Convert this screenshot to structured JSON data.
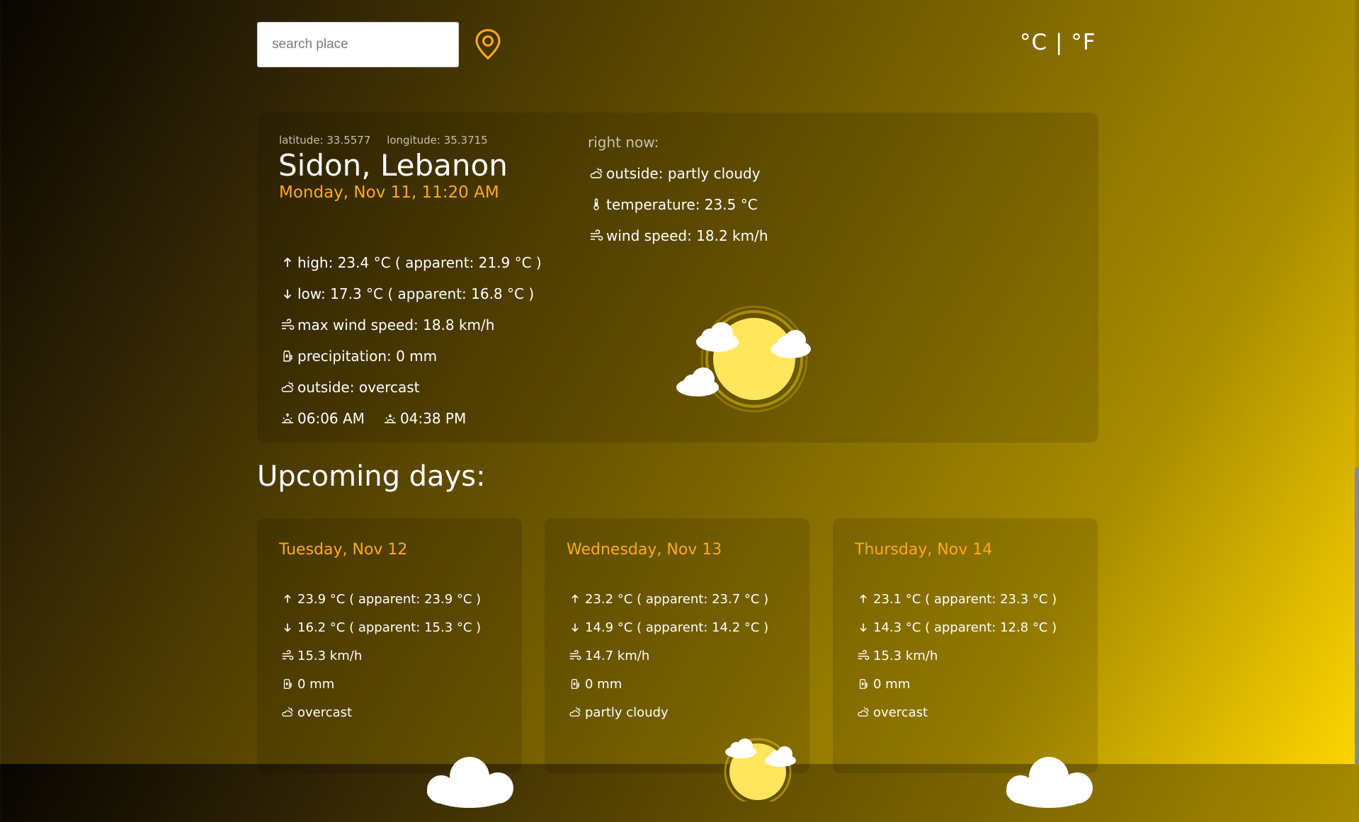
{
  "search": {
    "placeholder": "search place"
  },
  "units": {
    "celsius": "°C",
    "separator": "|",
    "fahrenheit": "°F"
  },
  "current": {
    "latitude": "latitude: 33.5577",
    "longitude": "longitude: 35.3715",
    "city": "Sidon, Lebanon",
    "date": "Monday, Nov 11, 11:20 AM",
    "high": "high: 23.4 °C ( apparent: 21.9 °C )",
    "low": "low: 17.3 °C ( apparent: 16.8 °C )",
    "max_wind": "max wind speed: 18.8 km/h",
    "precipitation": "precipitation: 0 mm",
    "outside": "outside: overcast",
    "sunrise": "06:06 AM",
    "sunset": "04:38 PM",
    "icon": "sun-with-clouds-icon"
  },
  "right_now": {
    "title": "right now:",
    "outside": "outside: partly cloudy",
    "temperature": "temperature: 23.5 °C",
    "wind": "wind speed: 18.2 km/h"
  },
  "upcoming": {
    "title": "Upcoming days:",
    "days": [
      {
        "date": "Tuesday, Nov 12",
        "high": "23.9 °C ( apparent: 23.9 °C )",
        "low": "16.2 °C ( apparent: 15.3 °C )",
        "wind": "15.3 km/h",
        "precip": "0 mm",
        "outside": "overcast",
        "icon": "cloud-icon"
      },
      {
        "date": "Wednesday, Nov 13",
        "high": "23.2 °C ( apparent: 23.7 °C )",
        "low": "14.9 °C ( apparent: 14.2 °C )",
        "wind": "14.7 km/h",
        "precip": "0 mm",
        "outside": "partly cloudy",
        "icon": "sun-with-clouds-icon"
      },
      {
        "date": "Thursday, Nov 14",
        "high": "23.1 °C ( apparent: 23.3 °C )",
        "low": "14.3 °C ( apparent: 12.8 °C )",
        "wind": "15.3 km/h",
        "precip": "0 mm",
        "outside": "overcast",
        "icon": "cloud-icon"
      }
    ]
  },
  "colors": {
    "accent": "#ffa91a",
    "sun": "#ffe65c",
    "cloud": "#ffffff"
  }
}
